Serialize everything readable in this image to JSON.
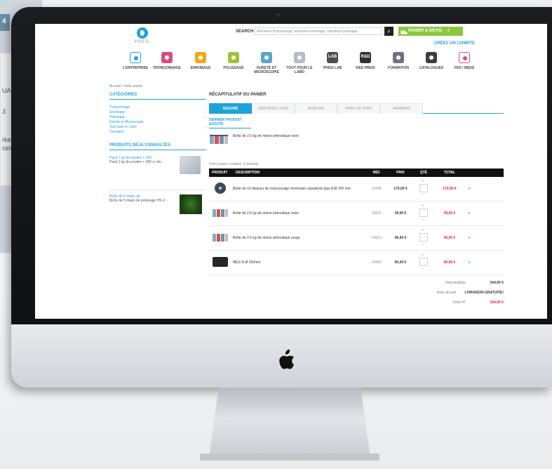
{
  "background": {
    "tab_number": "4",
    "card_lines": [
      "UAL",
      "3",
      "rket",
      "ces"
    ]
  },
  "header": {
    "logo_text": "PRESI",
    "search_label": "SEARCH",
    "search_placeholder": "Machines tronçonnage, machines enrobage, machines polissage",
    "cart_label": "PANIER & DEVIS",
    "cart_badge": "4",
    "create_account": "CRÉEZ UN COMPTE"
  },
  "nav": {
    "items": [
      {
        "label": "L'ENTREPRISE",
        "color": "#1ea2dc",
        "icon": "presi-icon"
      },
      {
        "label": "TRONÇONNAGE",
        "color": "#d94c7a",
        "icon": "cutting-icon"
      },
      {
        "label": "ENROBAGE",
        "color": "#f2a81d",
        "icon": "mounting-icon"
      },
      {
        "label": "POLISSAGE",
        "color": "#9bc43a",
        "icon": "polishing-icon"
      },
      {
        "label": "DURETÉ ET MICROSCOPIE",
        "color": "#5aa6c9",
        "icon": "hardness-icon"
      },
      {
        "label": "TOUT POUR LE LABO",
        "color": "#b4bcc4",
        "icon": "lab-icon"
      },
      {
        "label": "PRESI LAB",
        "color": "#4a4f55",
        "icon": "lab-badge-icon",
        "badge": "LAB"
      },
      {
        "label": "R&D PRESI",
        "color": "#2e3238",
        "icon": "rd-badge-icon",
        "badge": "R&D"
      },
      {
        "label": "FORMATION",
        "color": "#6a7480",
        "icon": "training-icon"
      },
      {
        "label": "CATALOGUES",
        "color": "#3a3e44",
        "icon": "catalog-icon"
      },
      {
        "label": "FDS / MSDS",
        "color": "#e04a7a",
        "icon": "msds-icon"
      }
    ]
  },
  "breadcrumb": {
    "home": "Accueil",
    "separator": "/",
    "current": "Votre panier"
  },
  "sidebar": {
    "categories_title": "CATÉGORIES",
    "categories": [
      "Tronçonnage",
      "Enrobage",
      "Polissage",
      "Dureté et Microscopie",
      "Tout pour le Labo",
      "Occasion"
    ],
    "viewed_title": "PRODUITS DÉJÀ CONSULTÉS",
    "viewed": {
      "name": "Pack 1 kg de poudre + 100",
      "desc": "Pack 1 kg de poudre + 300 cc de..."
    },
    "promo": {
      "name": "Boîte de 5 draps de",
      "desc": "Boîte de 5 draps de polissage HS-V..."
    }
  },
  "main": {
    "title": "RÉCAPITULATIF DU PANIER",
    "tabs": [
      "RÉSUMÉ",
      "IDENTIFIEZ-VOUS",
      "ADRESSE",
      "FRAIS DE PORT",
      "PAIEMENT"
    ],
    "added_title": "DERNIER PRODUIT AJOUTÉ",
    "added_item": "Boîte de 2.5 kg de résine phénolique noire",
    "cart_count": "Votre panier contient: 4 produits",
    "columns": {
      "product": "PRODUIT",
      "description": "DESCRIPTION",
      "ref": "RÉF.",
      "unit": "PRIX UNITAIRE",
      "qty": "QTÉ",
      "total": "TOTAL"
    },
    "rows": [
      {
        "desc": "Boîte de 10 disques de tronçonnage résinoïdes standards type A Ø 100 mm",
        "ref": "01040",
        "unit": "170,00 €",
        "total": "170,00 €",
        "thumb": "disc"
      },
      {
        "desc": "Boîte de 2.5 kg de résine phénolique noire",
        "ref": "03011",
        "unit": "39,00 €",
        "total": "39,00 €",
        "thumb": "jars"
      },
      {
        "desc": "Boîte de 2.5 kg de résine phénolique rouge",
        "ref": "03012",
        "unit": "45,00 €",
        "total": "45,00 €",
        "thumb": "jars"
      },
      {
        "desc": "MED R Ø 250mm",
        "ref": "24000",
        "unit": "90,00 €",
        "total": "90,00 €",
        "thumb": "pad"
      }
    ],
    "totals": {
      "products_label": "Total produits",
      "products_value": "344,00 €",
      "shipping_label": "Frais de port",
      "shipping_value": "LIVRAISON GRATUITE!",
      "ht_label": "Total HT",
      "ht_value": "344,00 €"
    }
  }
}
